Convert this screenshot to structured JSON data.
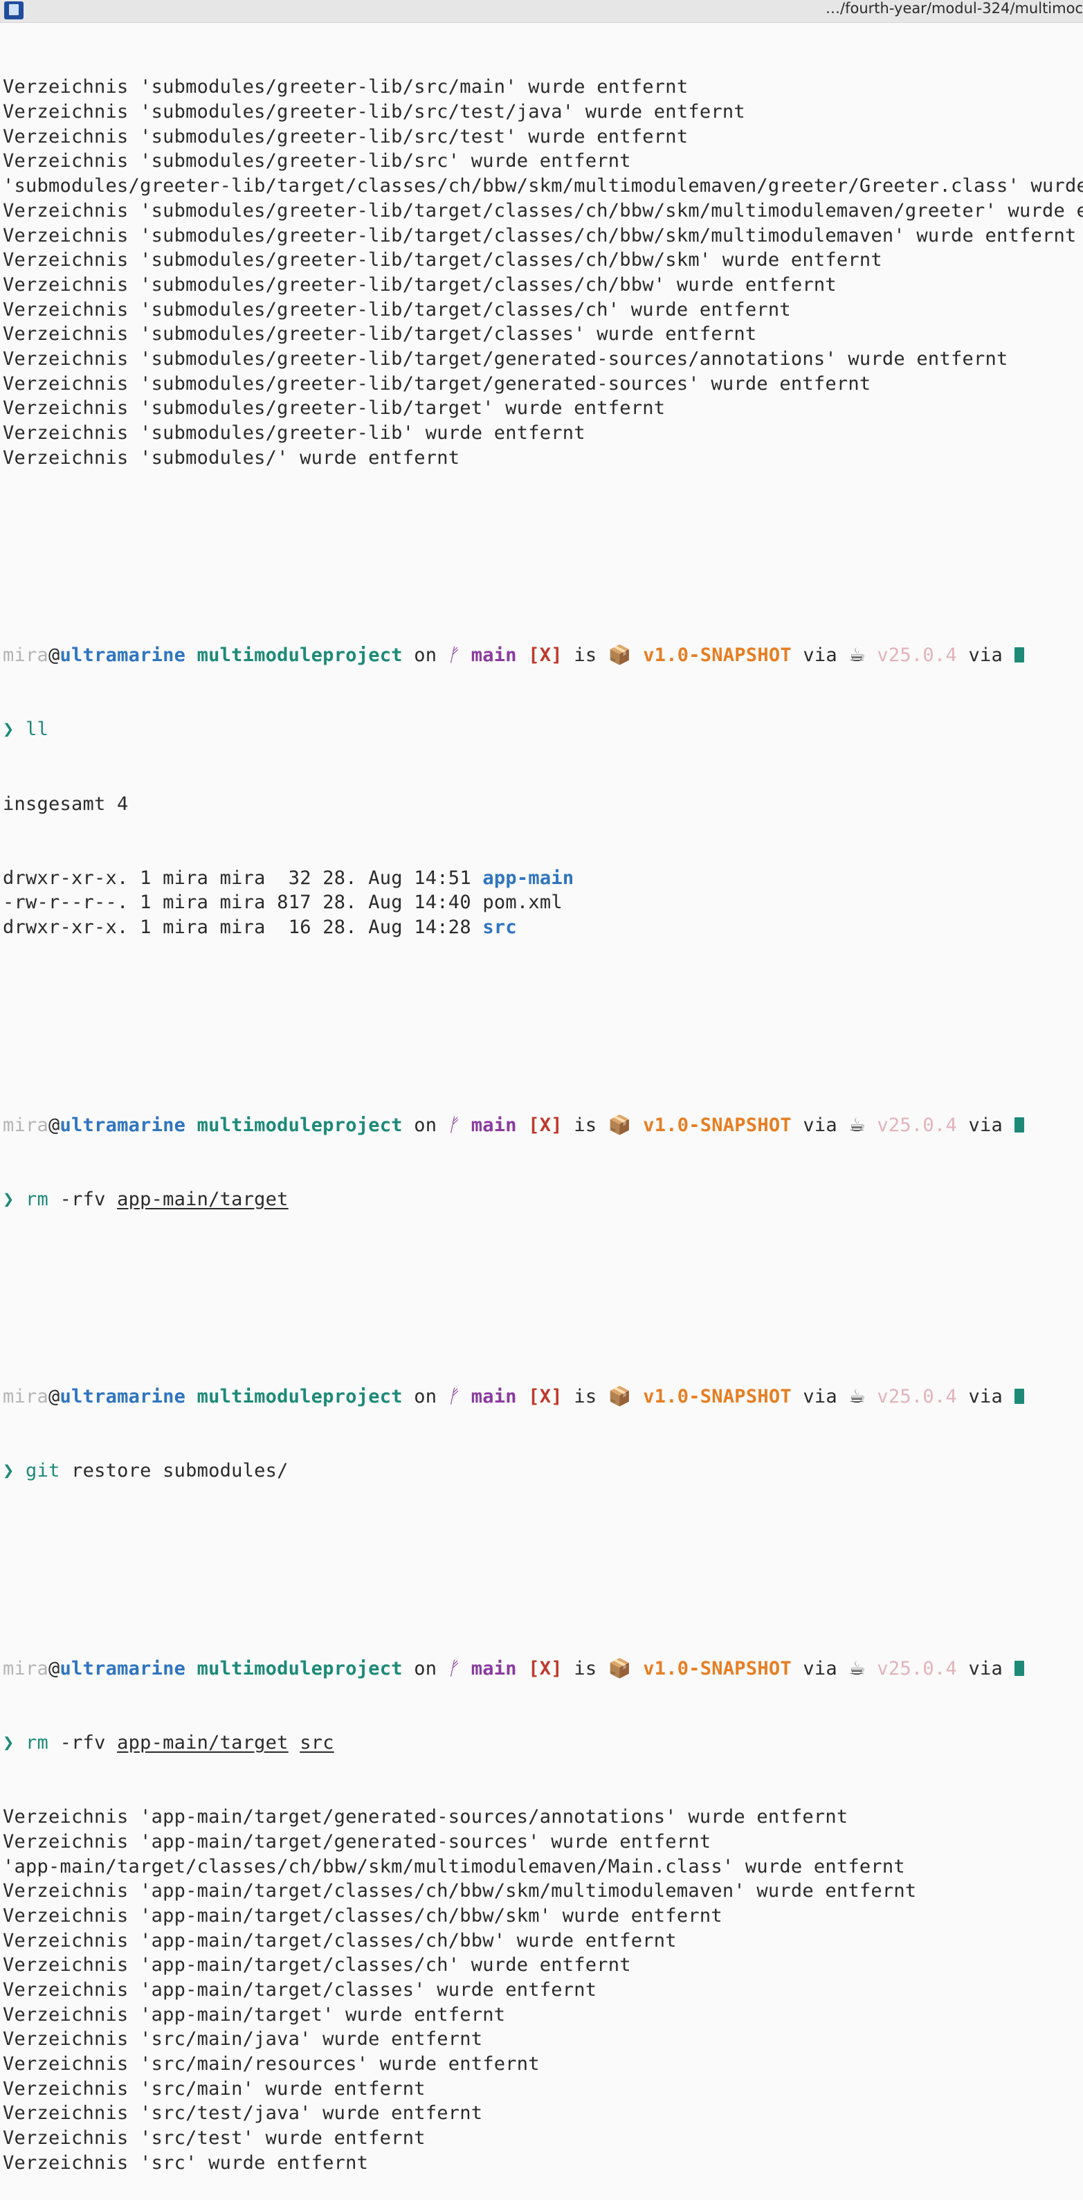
{
  "window": {
    "title": "…/fourth-year/modul-324/multimoc"
  },
  "colors": {
    "host": "#2f75c0",
    "directory": "#1d8a78",
    "branch": "#8a3b9f",
    "status": "#c0392b",
    "package_version": "#e67e22",
    "java_version": "#e3b2bc"
  },
  "output_block_1": [
    "Verzeichnis 'submodules/greeter-lib/src/main' wurde entfernt",
    "Verzeichnis 'submodules/greeter-lib/src/test/java' wurde entfernt",
    "Verzeichnis 'submodules/greeter-lib/src/test' wurde entfernt",
    "Verzeichnis 'submodules/greeter-lib/src' wurde entfernt",
    "'submodules/greeter-lib/target/classes/ch/bbw/skm/multimodulemaven/greeter/Greeter.class' wurde e",
    "Verzeichnis 'submodules/greeter-lib/target/classes/ch/bbw/skm/multimodulemaven/greeter' wurde ent",
    "Verzeichnis 'submodules/greeter-lib/target/classes/ch/bbw/skm/multimodulemaven' wurde entfernt",
    "Verzeichnis 'submodules/greeter-lib/target/classes/ch/bbw/skm' wurde entfernt",
    "Verzeichnis 'submodules/greeter-lib/target/classes/ch/bbw' wurde entfernt",
    "Verzeichnis 'submodules/greeter-lib/target/classes/ch' wurde entfernt",
    "Verzeichnis 'submodules/greeter-lib/target/classes' wurde entfernt",
    "Verzeichnis 'submodules/greeter-lib/target/generated-sources/annotations' wurde entfernt",
    "Verzeichnis 'submodules/greeter-lib/target/generated-sources' wurde entfernt",
    "Verzeichnis 'submodules/greeter-lib/target' wurde entfernt",
    "Verzeichnis 'submodules/greeter-lib' wurde entfernt",
    "Verzeichnis 'submodules/' wurde entfernt"
  ],
  "prompt": {
    "user": "mira",
    "at": "@",
    "host": "ultramarine",
    "directory": "multimoduleproject",
    "on": "on",
    "branch_icon": "ᚠ",
    "branch": "main",
    "status": "[X]",
    "is": "is",
    "package_icon": "📦",
    "package_version": "v1.0-SNAPSHOT",
    "via": "via",
    "java_icon": "☕",
    "java_version": "v25.0.4",
    "via2": "via",
    "maven_icon": "M",
    "arrow": "❯"
  },
  "commands": {
    "cmd1": {
      "name": "ll",
      "args": ""
    },
    "cmd2": {
      "name": "rm",
      "flags": "-rfv",
      "path1": "app-main/target"
    },
    "cmd3": {
      "name": "git",
      "args": "restore submodules/"
    },
    "cmd4": {
      "name": "rm",
      "flags": "-rfv",
      "path1": "app-main/target",
      "path2": "src"
    }
  },
  "ll_output": {
    "total": "insgesamt 4",
    "rows": [
      {
        "perms": "drwxr-xr-x.",
        "links": "1",
        "owner": "mira",
        "group": "mira",
        "size": " 32",
        "date": "28. Aug 14:51",
        "name": "app-main",
        "is_dir": true
      },
      {
        "perms": "-rw-r--r--.",
        "links": "1",
        "owner": "mira",
        "group": "mira",
        "size": "817",
        "date": "28. Aug 14:40",
        "name": "pom.xml",
        "is_dir": false
      },
      {
        "perms": "drwxr-xr-x.",
        "links": "1",
        "owner": "mira",
        "group": "mira",
        "size": " 16",
        "date": "28. Aug 14:28",
        "name": "src",
        "is_dir": true
      }
    ]
  },
  "output_block_2": [
    "Verzeichnis 'app-main/target/generated-sources/annotations' wurde entfernt",
    "Verzeichnis 'app-main/target/generated-sources' wurde entfernt",
    "'app-main/target/classes/ch/bbw/skm/multimodulemaven/Main.class' wurde entfernt",
    "Verzeichnis 'app-main/target/classes/ch/bbw/skm/multimodulemaven' wurde entfernt",
    "Verzeichnis 'app-main/target/classes/ch/bbw/skm' wurde entfernt",
    "Verzeichnis 'app-main/target/classes/ch/bbw' wurde entfernt",
    "Verzeichnis 'app-main/target/classes/ch' wurde entfernt",
    "Verzeichnis 'app-main/target/classes' wurde entfernt",
    "Verzeichnis 'app-main/target' wurde entfernt",
    "Verzeichnis 'src/main/java' wurde entfernt",
    "Verzeichnis 'src/main/resources' wurde entfernt",
    "Verzeichnis 'src/main' wurde entfernt",
    "Verzeichnis 'src/test/java' wurde entfernt",
    "Verzeichnis 'src/test' wurde entfernt",
    "Verzeichnis 'src' wurde entfernt"
  ]
}
